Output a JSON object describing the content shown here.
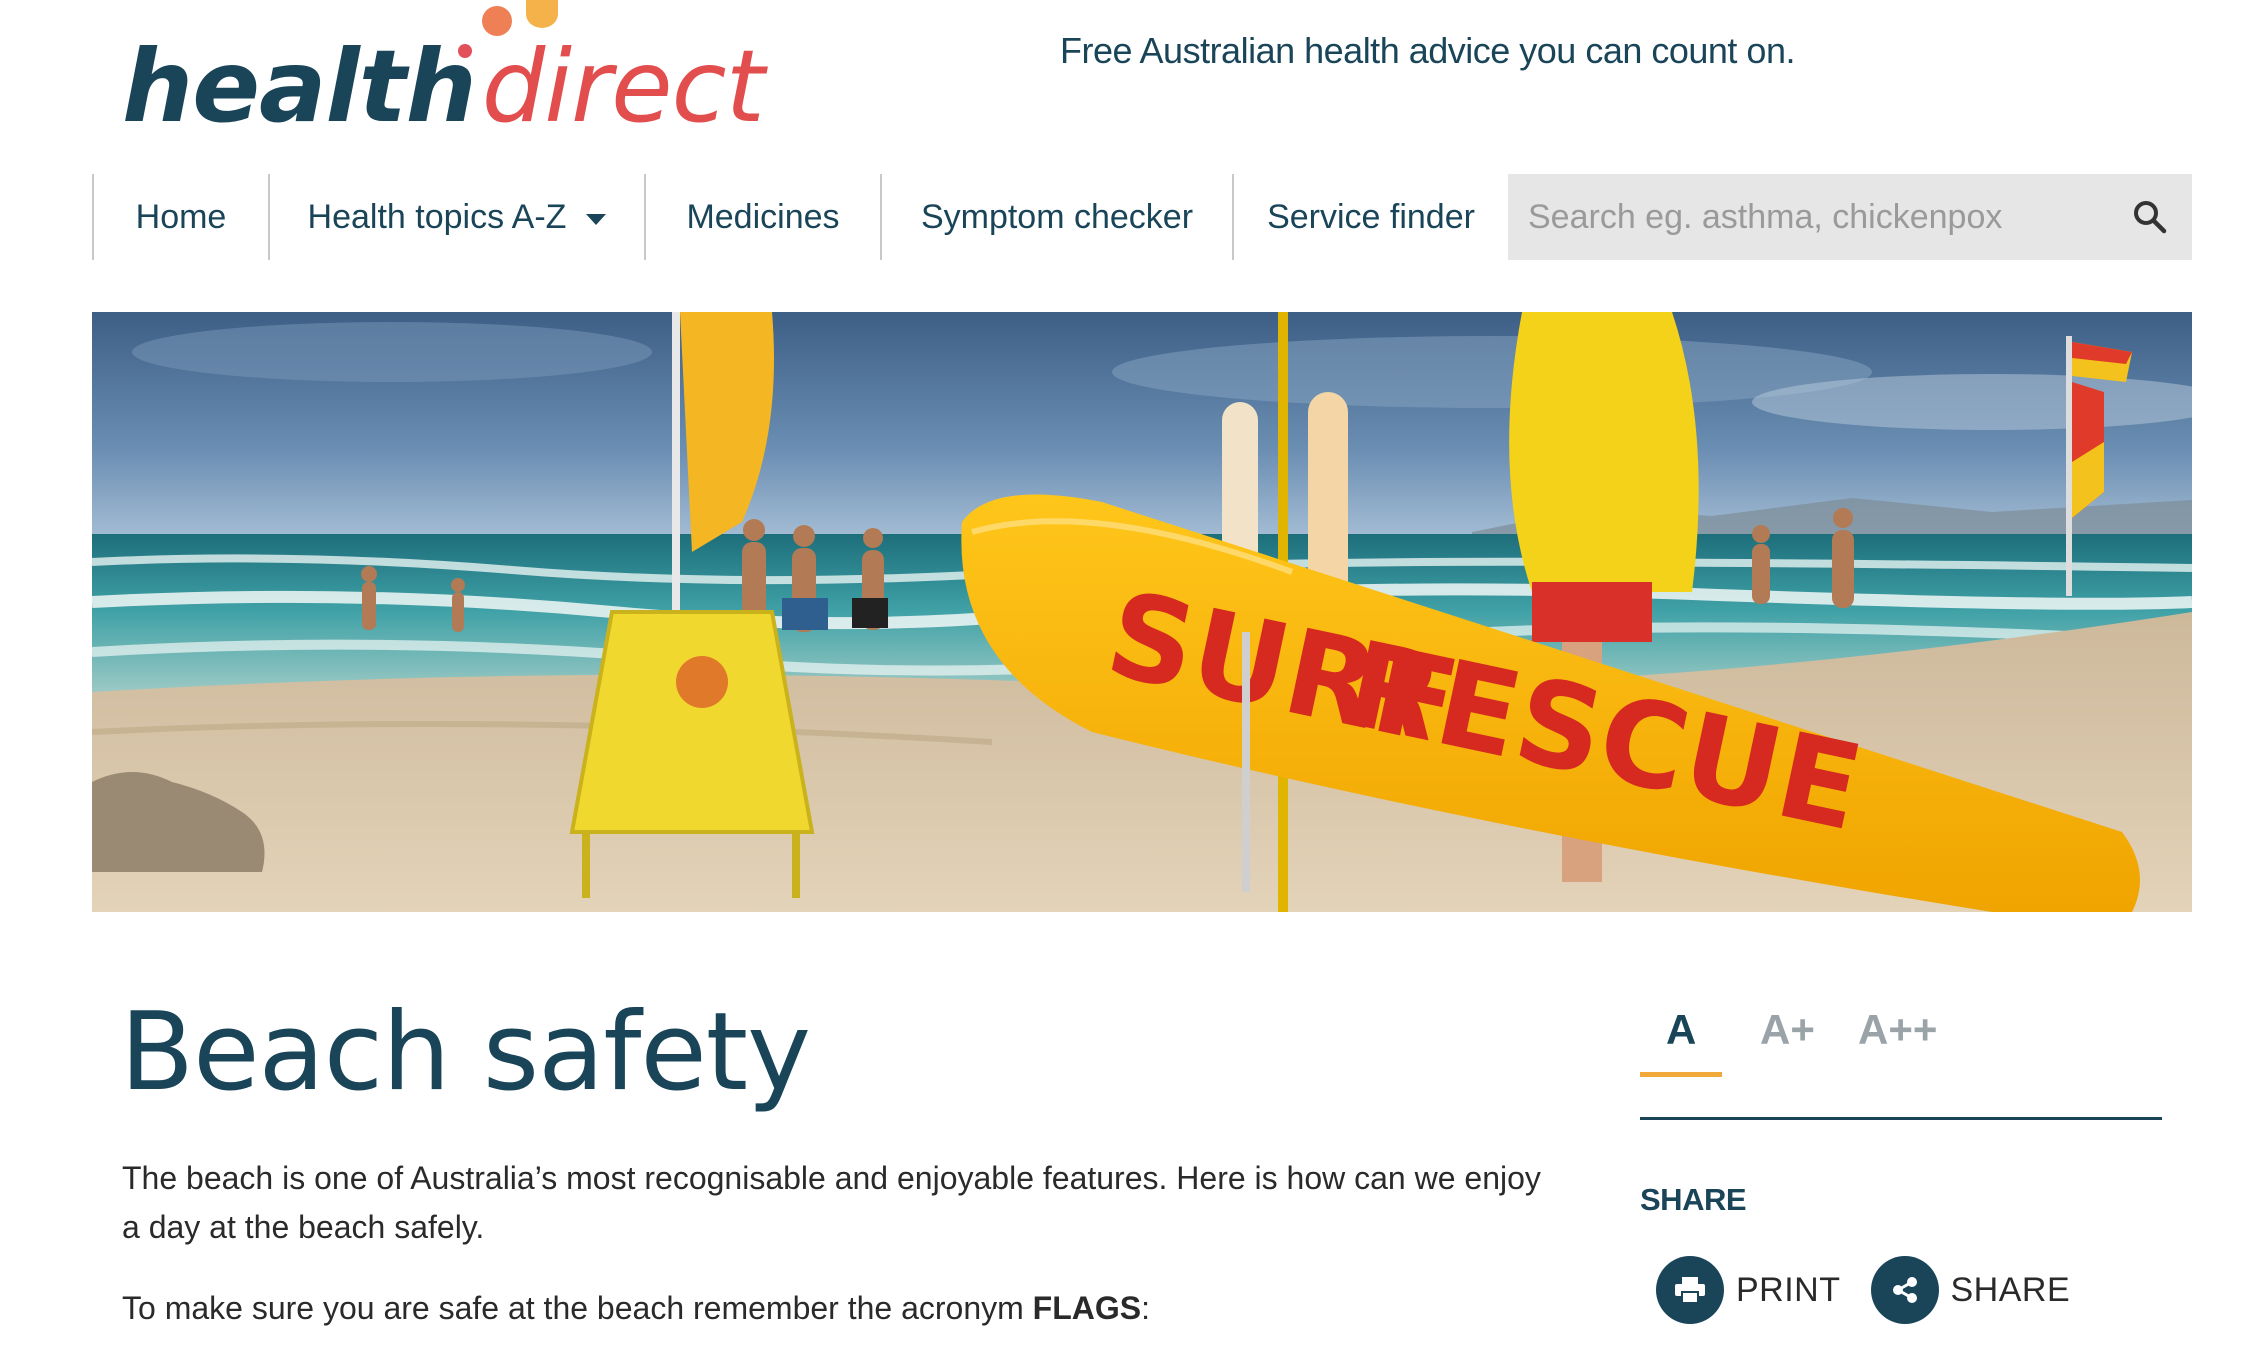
{
  "logo": {
    "part1": "health",
    "part2": "direct"
  },
  "tagline": "Free Australian health advice you can count on.",
  "nav": {
    "items": [
      {
        "label": "Home"
      },
      {
        "label": "Health topics A-Z"
      },
      {
        "label": "Medicines"
      },
      {
        "label": "Symptom checker"
      },
      {
        "label": "Service finder"
      }
    ]
  },
  "search": {
    "placeholder": "Search eg. asthma, chickenpox",
    "value": ""
  },
  "hero": {
    "board_text_1": "SURF",
    "board_text_2": "RESCUE"
  },
  "article": {
    "title": "Beach safety",
    "intro": "The beach is one of Australia’s most recognisable and enjoyable features. Here is how can we enjoy a day at the beach safely.",
    "flags_prefix": "To make sure you are safe at the beach remember the acronym ",
    "flags_word": "FLAGS",
    "flags_suffix": ":"
  },
  "font_size": {
    "options": [
      "A",
      "A+",
      "A++"
    ],
    "selected": "A"
  },
  "share": {
    "heading": "SHARE",
    "print_label": "PRINT",
    "share_label": "SHARE"
  },
  "colors": {
    "brand_navy": "#1a4559",
    "brand_red": "#e24d4d",
    "accent_orange": "#f2a93b",
    "search_bg": "#e6e6e6"
  },
  "icons": [
    "search-icon",
    "caret-down-icon",
    "print-icon",
    "share-icon"
  ]
}
